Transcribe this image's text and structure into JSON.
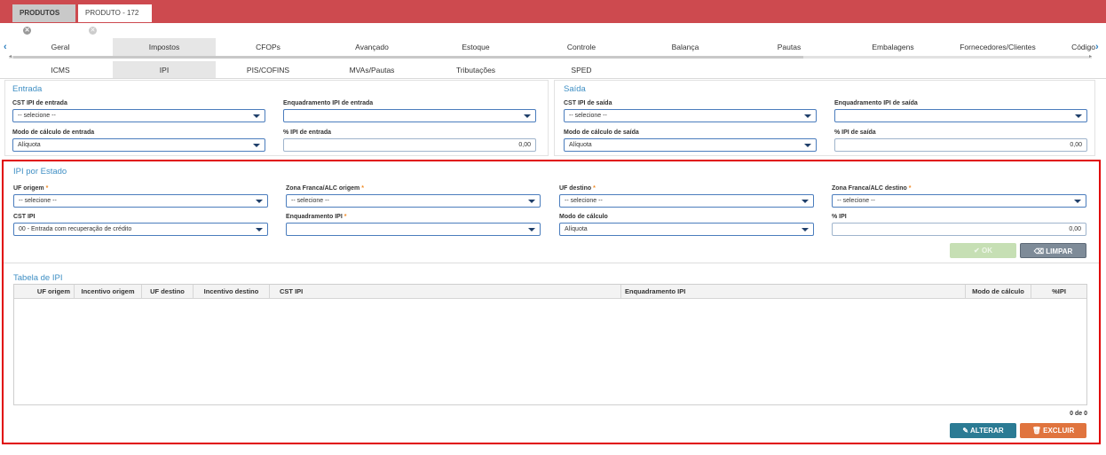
{
  "tabs": [
    {
      "label": "PRODUTOS",
      "active": false
    },
    {
      "label": "PRODUTO - 172",
      "active": true
    }
  ],
  "main_tabs": [
    "Geral",
    "Impostos",
    "CFOPs",
    "Avançado",
    "Estoque",
    "Controle",
    "Balança",
    "Pautas",
    "Embalagens",
    "Fornecedores/Clientes",
    "Código"
  ],
  "main_tabs_selected": "Impostos",
  "sub_tabs": [
    "ICMS",
    "IPI",
    "PIS/COFINS",
    "MVAs/Pautas",
    "Tributações",
    "SPED"
  ],
  "sub_tabs_selected": "IPI",
  "entrada": {
    "title": "Entrada",
    "cst_label": "CST IPI de entrada",
    "cst_value": "-- selecione --",
    "enq_label": "Enquadramento IPI de entrada",
    "enq_value": "",
    "modo_label": "Modo de cálculo de entrada",
    "modo_value": "Alíquota",
    "pct_label": "% IPI de entrada",
    "pct_value": "0,00"
  },
  "saida": {
    "title": "Saída",
    "cst_label": "CST IPI de saída",
    "cst_value": "-- selecione --",
    "enq_label": "Enquadramento IPI de saída",
    "enq_value": "",
    "modo_label": "Modo de cálculo de saída",
    "modo_value": "Alíquota",
    "pct_label": "% IPI de saída",
    "pct_value": "0,00"
  },
  "estado": {
    "title": "IPI por Estado",
    "uf_origem_label": "UF origem",
    "uf_origem_value": "-- selecione --",
    "zf_origem_label": "Zona Franca/ALC origem",
    "zf_origem_value": "-- selecione --",
    "uf_destino_label": "UF destino",
    "uf_destino_value": "-- selecione --",
    "zf_destino_label": "Zona Franca/ALC destino",
    "zf_destino_value": "-- selecione --",
    "cst_label": "CST IPI",
    "cst_value": "00 - Entrada com recuperação de crédito",
    "enq_label": "Enquadramento IPI",
    "enq_value": "",
    "modo_label": "Modo de cálculo",
    "modo_value": "Alíquota",
    "pct_label": "% IPI",
    "pct_value": "0,00",
    "required_mark": "*",
    "ok_label": "OK",
    "limpar_label": "LIMPAR"
  },
  "tabela": {
    "title": "Tabela de IPI",
    "columns": [
      "UF origem",
      "Incentivo origem",
      "UF destino",
      "Incentivo destino",
      "CST IPI",
      "Enquadramento IPI",
      "Modo de cálculo",
      "%IPI"
    ],
    "rows": [],
    "count": "0 de 0",
    "alterar_label": "ALTERAR",
    "excluir_label": "EXCLUIR"
  },
  "icons": {
    "close": "close-circle-icon",
    "left": "chevron-left-icon",
    "right": "chevron-right-icon",
    "check": "check-icon",
    "eraser": "eraser-icon",
    "pencil": "pencil-icon",
    "trash": "trash-icon"
  },
  "colors": {
    "topbar": "#cd4a4f",
    "accent": "#3f8fc4",
    "highlight": "#e00000",
    "alterar": "#2b7b94",
    "excluir": "#e0743e",
    "ok": "#c6dfb4",
    "limpar": "#7e8b98"
  }
}
